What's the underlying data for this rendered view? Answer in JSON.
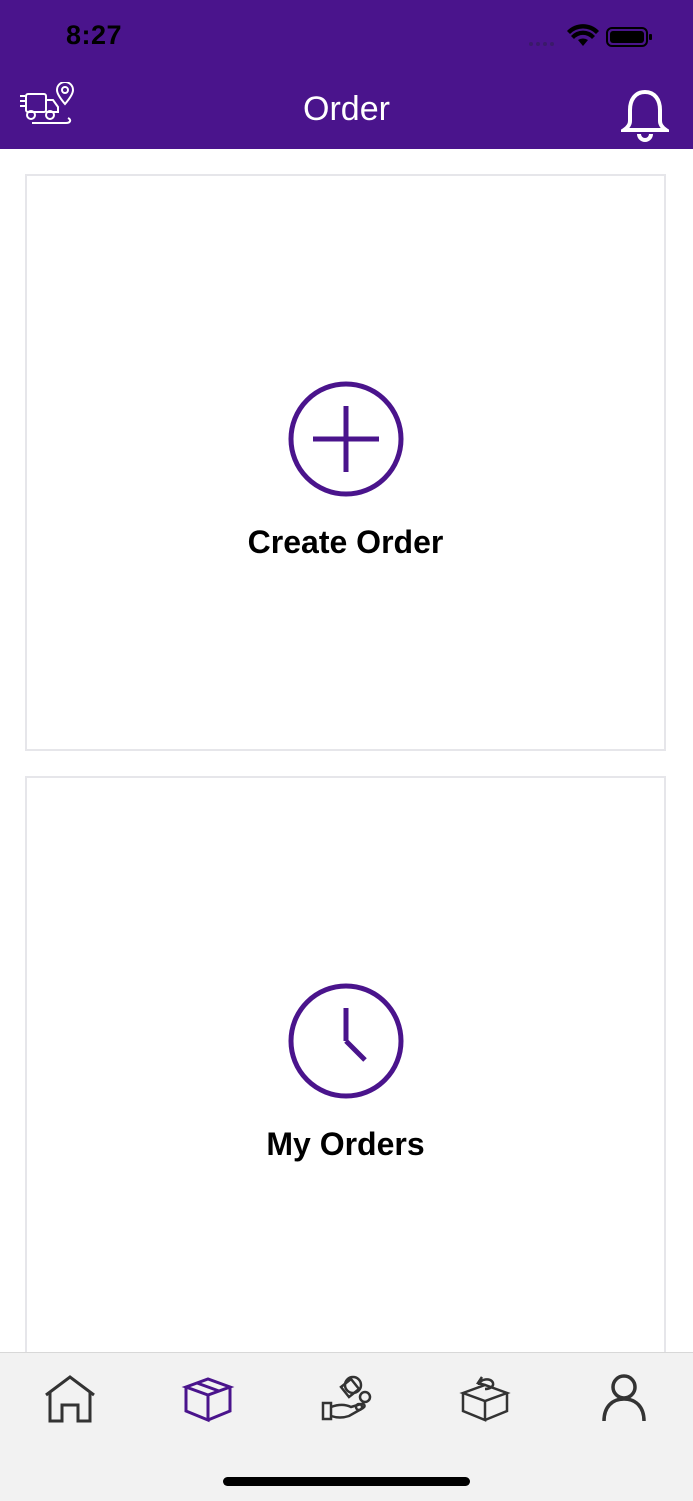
{
  "status_bar": {
    "time": "8:27"
  },
  "header": {
    "title": "Order"
  },
  "cards": {
    "create_order": {
      "label": "Create Order"
    },
    "my_orders": {
      "label": "My Orders"
    }
  },
  "tabs": [
    {
      "icon": "home-icon",
      "active": false
    },
    {
      "icon": "package-icon",
      "active": true
    },
    {
      "icon": "payment-icon",
      "active": false
    },
    {
      "icon": "return-package-icon",
      "active": false
    },
    {
      "icon": "profile-icon",
      "active": false
    }
  ],
  "colors": {
    "brand": "#4a148c",
    "icon_gray": "#333333",
    "tabbar_bg": "#f2f2f2"
  }
}
